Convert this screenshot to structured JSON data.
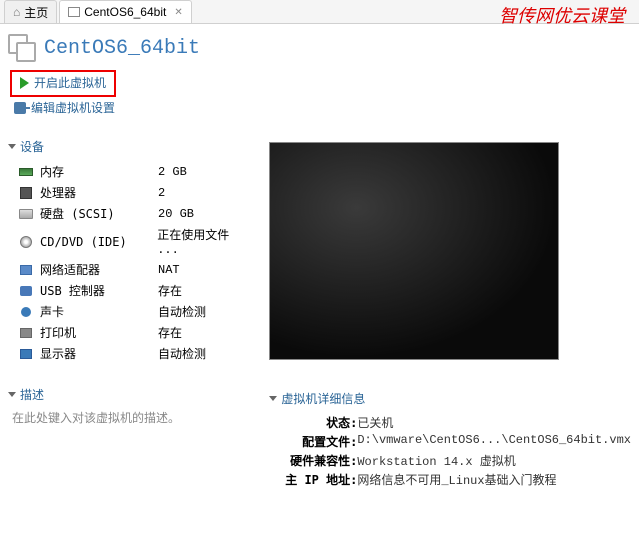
{
  "tabs": [
    {
      "label": "主页"
    },
    {
      "label": "CentOS6_64bit"
    }
  ],
  "watermark": "智传网优云课堂",
  "vm_title": "CentOS6_64bit",
  "actions": {
    "power_on": "开启此虚拟机",
    "edit_settings": "编辑虚拟机设置"
  },
  "sections": {
    "devices": "设备",
    "description": "描述",
    "details": "虚拟机详细信息"
  },
  "devices": [
    {
      "icon": "mem",
      "name": "内存",
      "value": "2 GB"
    },
    {
      "icon": "cpu",
      "name": "处理器",
      "value": "2"
    },
    {
      "icon": "disk",
      "name": "硬盘 (SCSI)",
      "value": "20 GB"
    },
    {
      "icon": "cd",
      "name": "CD/DVD (IDE)",
      "value": "正在使用文件 ..."
    },
    {
      "icon": "net",
      "name": "网络适配器",
      "value": "NAT"
    },
    {
      "icon": "usb",
      "name": "USB 控制器",
      "value": "存在"
    },
    {
      "icon": "sound",
      "name": "声卡",
      "value": "自动检测"
    },
    {
      "icon": "print",
      "name": "打印机",
      "value": "存在"
    },
    {
      "icon": "display",
      "name": "显示器",
      "value": "自动检测"
    }
  ],
  "description_placeholder": "在此处键入对该虚拟机的描述。",
  "details": [
    {
      "label": "状态:",
      "value": "已关机"
    },
    {
      "label": "配置文件:",
      "value": "D:\\vmware\\CentOS6...\\CentOS6_64bit.vmx"
    },
    {
      "label": "硬件兼容性:",
      "value": "Workstation 14.x 虚拟机"
    },
    {
      "label": "主 IP 地址:",
      "value": "网络信息不可用_Linux基础入门教程"
    }
  ]
}
